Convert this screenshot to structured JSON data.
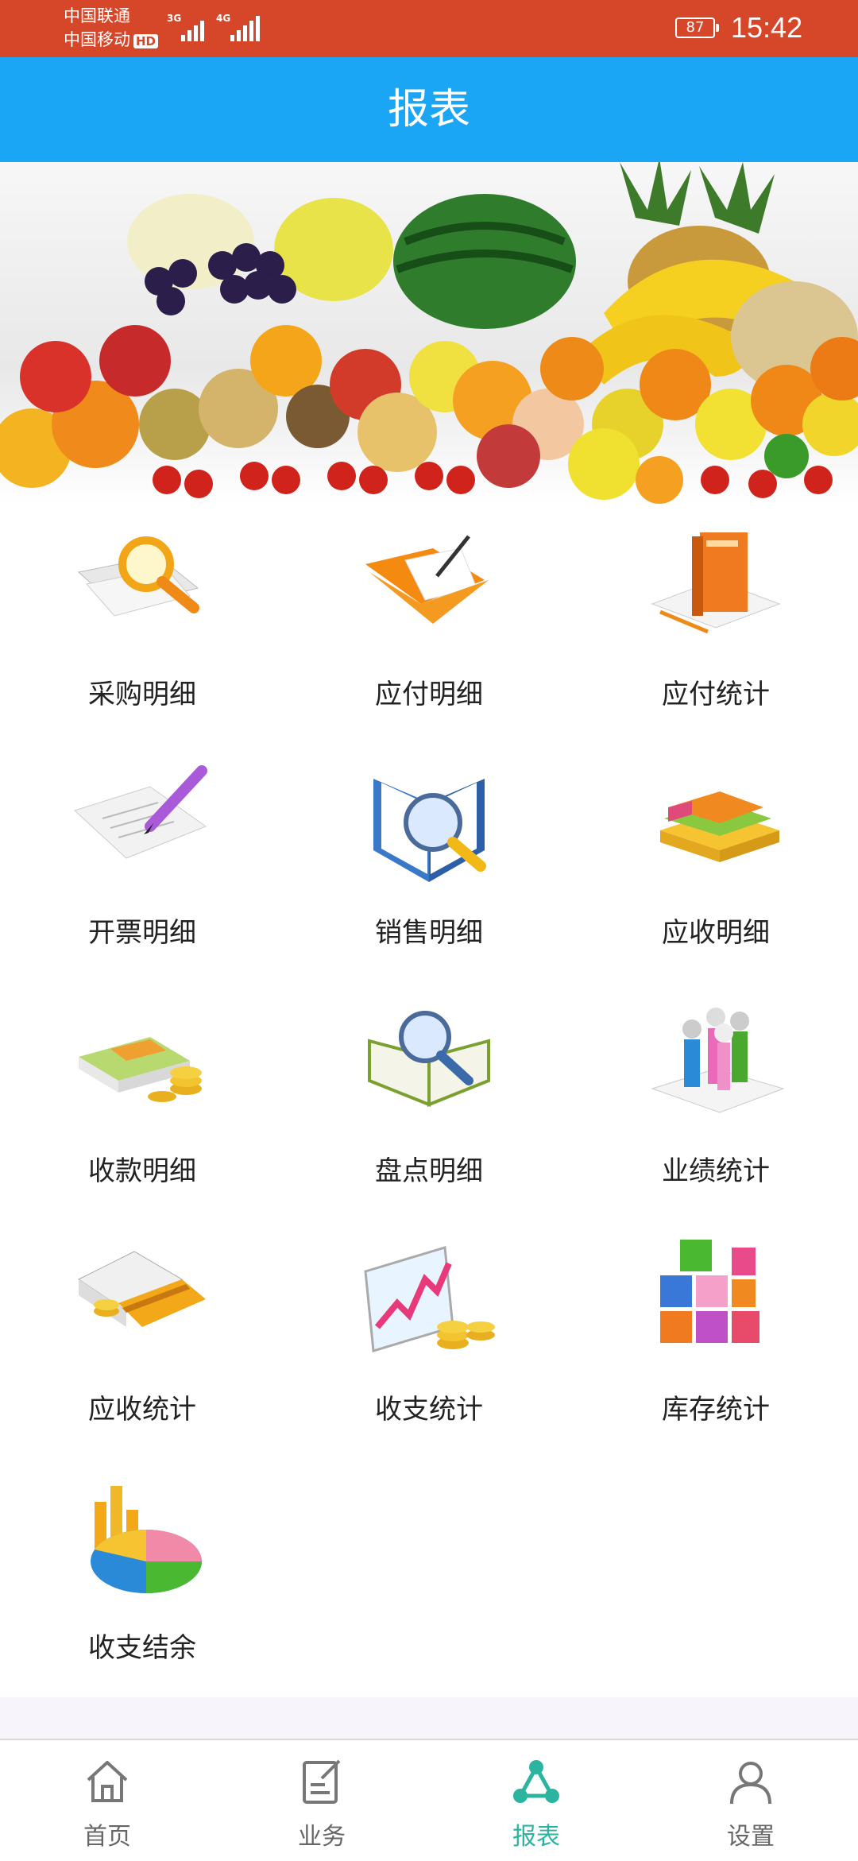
{
  "status_bar": {
    "carrier1": "中国联通",
    "carrier2": "中国移动",
    "hd_badge": "HD",
    "network1": "3G",
    "network2": "4G",
    "battery": "87",
    "time": "15:42"
  },
  "header": {
    "title": "报表"
  },
  "banner": {
    "icon": "fruits-banner-image"
  },
  "reports": [
    {
      "label": "采购明细",
      "icon": "magnifier-on-documents-icon"
    },
    {
      "label": "应付明细",
      "icon": "folder-with-pen-icon"
    },
    {
      "label": "应付统计",
      "icon": "book-on-paper-icon"
    },
    {
      "label": "开票明细",
      "icon": "pencil-on-paper-icon"
    },
    {
      "label": "销售明细",
      "icon": "magnifier-on-book-icon"
    },
    {
      "label": "应收明细",
      "icon": "stacked-books-icon"
    },
    {
      "label": "收款明细",
      "icon": "money-and-coins-icon"
    },
    {
      "label": "盘点明细",
      "icon": "magnifier-on-open-book-icon"
    },
    {
      "label": "业绩统计",
      "icon": "people-on-chart-icon"
    },
    {
      "label": "应收统计",
      "icon": "credit-card-and-coins-icon"
    },
    {
      "label": "收支统计",
      "icon": "chart-with-coins-icon"
    },
    {
      "label": "库存统计",
      "icon": "stacked-cubes-icon"
    },
    {
      "label": "收支结余",
      "icon": "pie-and-bar-chart-icon"
    }
  ],
  "bottom_nav": [
    {
      "label": "首页",
      "icon": "home-icon",
      "active": false
    },
    {
      "label": "业务",
      "icon": "edit-document-icon",
      "active": false
    },
    {
      "label": "报表",
      "icon": "share-nodes-icon",
      "active": true
    },
    {
      "label": "设置",
      "icon": "user-icon",
      "active": false
    }
  ],
  "colors": {
    "status_bar": "#d6472a",
    "header": "#1aa5f5",
    "nav_active": "#2bb5a0",
    "nav_inactive": "#666666"
  }
}
